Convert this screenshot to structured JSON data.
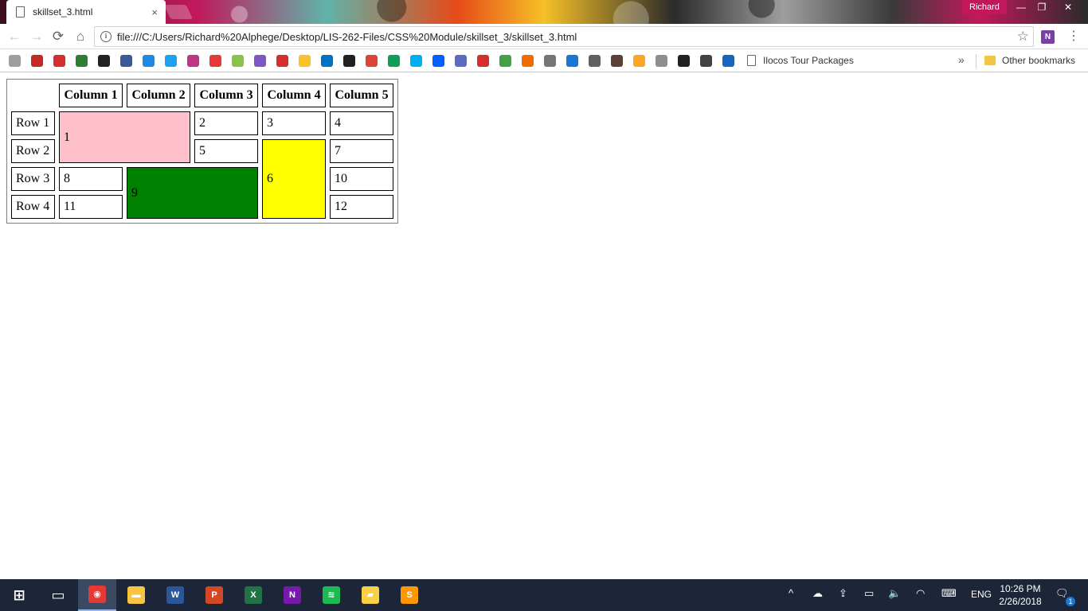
{
  "browser": {
    "tab_title": "skillset_3.html",
    "tab_close": "×",
    "profile_name": "Richard",
    "window_controls": {
      "minimize": "—",
      "restore": "❐",
      "close": "✕"
    },
    "nav": {
      "back": "←",
      "forward": "→",
      "reload": "⟳",
      "home": "⌂"
    },
    "url": "file:///C:/Users/Richard%20Alphege/Desktop/LIS-262-Files/CSS%20Module/skillset_3/skillset_3.html",
    "info_icon": "i",
    "star_icon": "☆",
    "extension_label": "N",
    "menu_icon": "⋮"
  },
  "bookmarks": {
    "icons": [
      {
        "name": "reload-bookmark-icon",
        "color": "#9e9e9e"
      },
      {
        "name": "gmail-icon",
        "color": "#c62828"
      },
      {
        "name": "shield-bookmark-icon",
        "color": "#d32f2f"
      },
      {
        "name": "xbox-icon",
        "color": "#2e7d32"
      },
      {
        "name": "github-icon",
        "color": "#212121"
      },
      {
        "name": "facebook-icon",
        "color": "#3b5998"
      },
      {
        "name": "messenger-icon",
        "color": "#1e88e5"
      },
      {
        "name": "twitter-icon",
        "color": "#1da1f2"
      },
      {
        "name": "instagram-icon",
        "color": "#c13584"
      },
      {
        "name": "youtube-icon",
        "color": "#e53935"
      },
      {
        "name": "google-photos-icon",
        "color": "#8bc34a"
      },
      {
        "name": "email-bookmark-icon",
        "color": "#7e57c2"
      },
      {
        "name": "gmail-alt-icon",
        "color": "#d32f2f"
      },
      {
        "name": "chrome-icon",
        "color": "#fbc02d"
      },
      {
        "name": "outlook-icon",
        "color": "#0072c6"
      },
      {
        "name": "spotify-icon",
        "color": "#212121"
      },
      {
        "name": "google-plus-icon",
        "color": "#db4437"
      },
      {
        "name": "sheets-icon",
        "color": "#0f9d58"
      },
      {
        "name": "skype-icon",
        "color": "#00aff0"
      },
      {
        "name": "dropbox-icon",
        "color": "#0061ff"
      },
      {
        "name": "cross-bookmark-icon",
        "color": "#5c6bc0"
      },
      {
        "name": "opera-icon",
        "color": "#d32f2f"
      },
      {
        "name": "circle-bookmark-icon",
        "color": "#43a047"
      },
      {
        "name": "kotlin-icon",
        "color": "#ef6c00"
      },
      {
        "name": "page-bookmark-icon",
        "color": "#757575"
      },
      {
        "name": "shield-blue-icon",
        "color": "#1976d2"
      },
      {
        "name": "docs-bookmark-icon",
        "color": "#616161"
      },
      {
        "name": "news-bookmark-icon",
        "color": "#5d4037"
      },
      {
        "name": "layers-icon",
        "color": "#f9a825"
      },
      {
        "name": "puzzle-icon",
        "color": "#8e8e8e"
      },
      {
        "name": "museum-icon",
        "color": "#212121"
      },
      {
        "name": "tree-icon",
        "color": "#424242"
      },
      {
        "name": "book-bookmark-icon",
        "color": "#1565c0"
      }
    ],
    "ilocos_label": "Ilocos Tour Packages",
    "more": "»",
    "other_label": "Other bookmarks"
  },
  "table": {
    "columns": [
      "Column 1",
      "Column 2",
      "Column 3",
      "Column 4",
      "Column 5"
    ],
    "rows": [
      "Row 1",
      "Row 2",
      "Row 3",
      "Row 4"
    ],
    "cells": {
      "c1": "1",
      "c2": "2",
      "c3": "3",
      "c4": "4",
      "c5": "5",
      "c6": "6",
      "c7": "7",
      "c8": "8",
      "c9": "9",
      "c10": "10",
      "c11": "11",
      "c12": "12"
    },
    "colors": {
      "pink": "#ffc0cb",
      "yellow": "#ffff00",
      "green": "#008000"
    }
  },
  "taskbar": {
    "apps": [
      {
        "name": "start-button",
        "label": "⊞",
        "color": "transparent"
      },
      {
        "name": "task-view-button",
        "label": "▭",
        "color": "transparent"
      },
      {
        "name": "chrome-taskbar-icon",
        "label": "◉",
        "color": "#e53935"
      },
      {
        "name": "file-explorer-icon",
        "label": "▬",
        "color": "#f9c440"
      },
      {
        "name": "word-icon",
        "label": "W",
        "color": "#2b579a"
      },
      {
        "name": "powerpoint-icon",
        "label": "P",
        "color": "#d24726"
      },
      {
        "name": "excel-icon",
        "label": "X",
        "color": "#217346"
      },
      {
        "name": "onenote-icon",
        "label": "N",
        "color": "#7719aa"
      },
      {
        "name": "spotify-taskbar-icon",
        "label": "≋",
        "color": "#1db954"
      },
      {
        "name": "sticky-notes-icon",
        "label": "▰",
        "color": "#f7d046"
      },
      {
        "name": "sublime-text-icon",
        "label": "S",
        "color": "#ff9800"
      }
    ],
    "tray": {
      "chevron": "^",
      "cloud": "☁",
      "network": "⇪",
      "battery": "▭",
      "volume": "🔈",
      "wifi": "◠",
      "keyboard": "⌨",
      "language": "ENG",
      "notification": "🗨",
      "notification_count": "1"
    },
    "time": "10:26 PM",
    "date": "2/26/2018"
  }
}
